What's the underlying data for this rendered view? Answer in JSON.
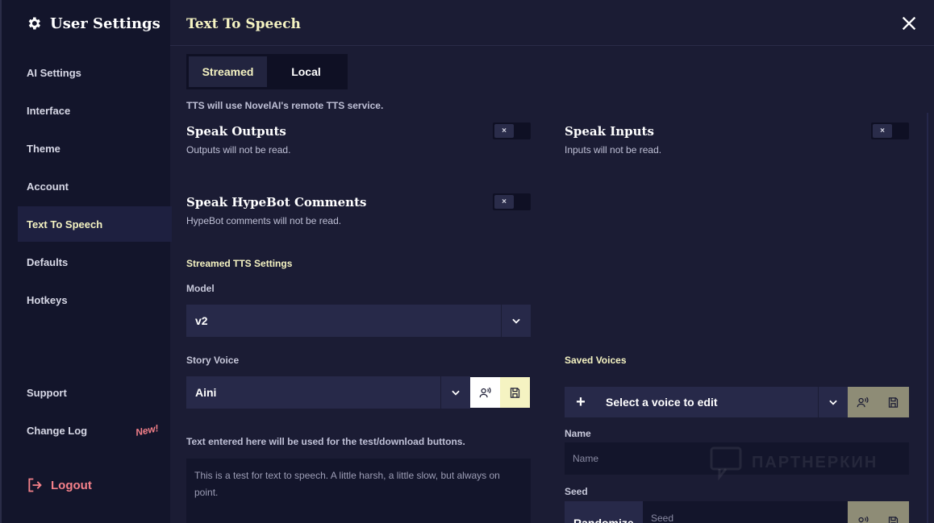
{
  "sidebar": {
    "title": "User Settings",
    "items": [
      {
        "label": "AI Settings"
      },
      {
        "label": "Interface"
      },
      {
        "label": "Theme"
      },
      {
        "label": "Account"
      },
      {
        "label": "Text To Speech"
      },
      {
        "label": "Defaults"
      },
      {
        "label": "Hotkeys"
      }
    ],
    "bottom_items": [
      {
        "label": "Support"
      },
      {
        "label": "Change Log"
      }
    ],
    "new_badge": "New!",
    "logout_label": "Logout",
    "active_item": "Text To Speech"
  },
  "header": {
    "title": "Text To Speech"
  },
  "mode_tabs": {
    "streamed": "Streamed",
    "local": "Local",
    "active": "Streamed"
  },
  "mode_description": "TTS will use NovelAI's remote TTS service.",
  "toggles": {
    "speak_outputs": {
      "title": "Speak Outputs",
      "description": "Outputs will not be read.",
      "state": "off",
      "glyph": "×"
    },
    "speak_inputs": {
      "title": "Speak Inputs",
      "description": "Inputs will not be read.",
      "state": "off",
      "glyph": "×"
    },
    "speak_hypebot": {
      "title": "Speak HypeBot Comments",
      "description": "HypeBot comments will not be read.",
      "state": "off",
      "glyph": "×"
    }
  },
  "streamed_settings": {
    "section_title": "Streamed TTS Settings",
    "model_label": "Model",
    "model_value": "v2",
    "story_voice_label": "Story Voice",
    "story_voice_value": "Aini",
    "test_text_label": "Text entered here will be used for the test/download buttons.",
    "test_text_value": "This is a test for text to speech. A little harsh, a little slow, but always on point."
  },
  "saved_voices": {
    "section_title": "Saved Voices",
    "add_glyph": "+",
    "select_placeholder": "Select a voice to edit",
    "name_label": "Name",
    "name_placeholder": "Name",
    "seed_label": "Seed",
    "randomize_label": "Randomize",
    "seed_placeholder": "Seed"
  },
  "watermark": "ПАРТНЕРКИН",
  "colors": {
    "background": "#1b1c34",
    "sidebar": "#13152b",
    "accent_yellow": "#f5f3c2",
    "logout_red": "#f5818a",
    "input_bg": "#272949",
    "save_button_bg": "#f5f3c2"
  }
}
